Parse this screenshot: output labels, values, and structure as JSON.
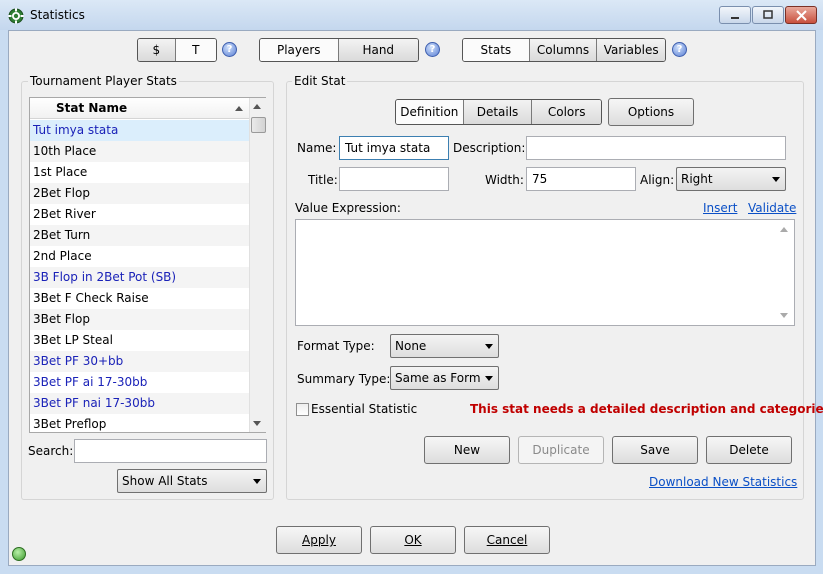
{
  "window": {
    "title": "Statistics"
  },
  "top_toolbar": {
    "currency": [
      "$",
      "T"
    ],
    "scope": [
      "Players",
      "Hand"
    ],
    "view": [
      "Stats",
      "Columns",
      "Variables"
    ],
    "help_glyph": "?"
  },
  "left_panel": {
    "group_title": "Tournament Player Stats",
    "column_header": "Stat Name",
    "rows": [
      {
        "label": "Tut imya stata",
        "blue": true,
        "selected": true
      },
      {
        "label": "10th Place",
        "blue": false
      },
      {
        "label": "1st Place",
        "blue": false
      },
      {
        "label": "2Bet Flop",
        "blue": false
      },
      {
        "label": "2Bet River",
        "blue": false
      },
      {
        "label": "2Bet Turn",
        "blue": false
      },
      {
        "label": "2nd Place",
        "blue": false
      },
      {
        "label": "3B Flop in 2Bet Pot (SB)",
        "blue": true
      },
      {
        "label": "3Bet F Check Raise",
        "blue": false
      },
      {
        "label": "3Bet Flop",
        "blue": false
      },
      {
        "label": "3Bet LP Steal",
        "blue": false
      },
      {
        "label": "3Bet PF 30+bb",
        "blue": true
      },
      {
        "label": "3Bet PF ai 17-30bb",
        "blue": true
      },
      {
        "label": "3Bet PF nai 17-30bb",
        "blue": true
      },
      {
        "label": "3Bet Preflop",
        "blue": false
      }
    ],
    "search_label": "Search:",
    "search_value": "",
    "filter_selected": "Show All Stats"
  },
  "edit_stat": {
    "group_title": "Edit Stat",
    "tabs": [
      "Definition",
      "Details",
      "Colors"
    ],
    "options_label": "Options",
    "name_label": "Name:",
    "name_value": "Tut imya stata",
    "description_label": "Description:",
    "description_value": "",
    "title_label": "Title:",
    "title_value": "",
    "width_label": "Width:",
    "width_value": "75",
    "align_label": "Align:",
    "align_value": "Right",
    "value_expression_label": "Value Expression:",
    "insert_link": "Insert",
    "validate_link": "Validate",
    "value_expression": "",
    "format_type_label": "Format Type:",
    "format_type_value": "None",
    "summary_type_label": "Summary Type:",
    "summary_type_value": "Same as Form",
    "essential_label": "Essential Statistic",
    "essential_checked": false,
    "warning": "This stat needs a detailed description and categories",
    "buttons": {
      "new": "New",
      "duplicate": "Duplicate",
      "save": "Save",
      "delete": "Delete"
    },
    "download_link": "Download New Statistics"
  },
  "footer": {
    "apply": "Apply",
    "ok": "OK",
    "cancel": "Cancel"
  },
  "colors": {
    "warning": "#c00000",
    "link": "#0a4fc6",
    "custom_stat": "#1a22b8",
    "selected_row": "#dbeefc"
  }
}
